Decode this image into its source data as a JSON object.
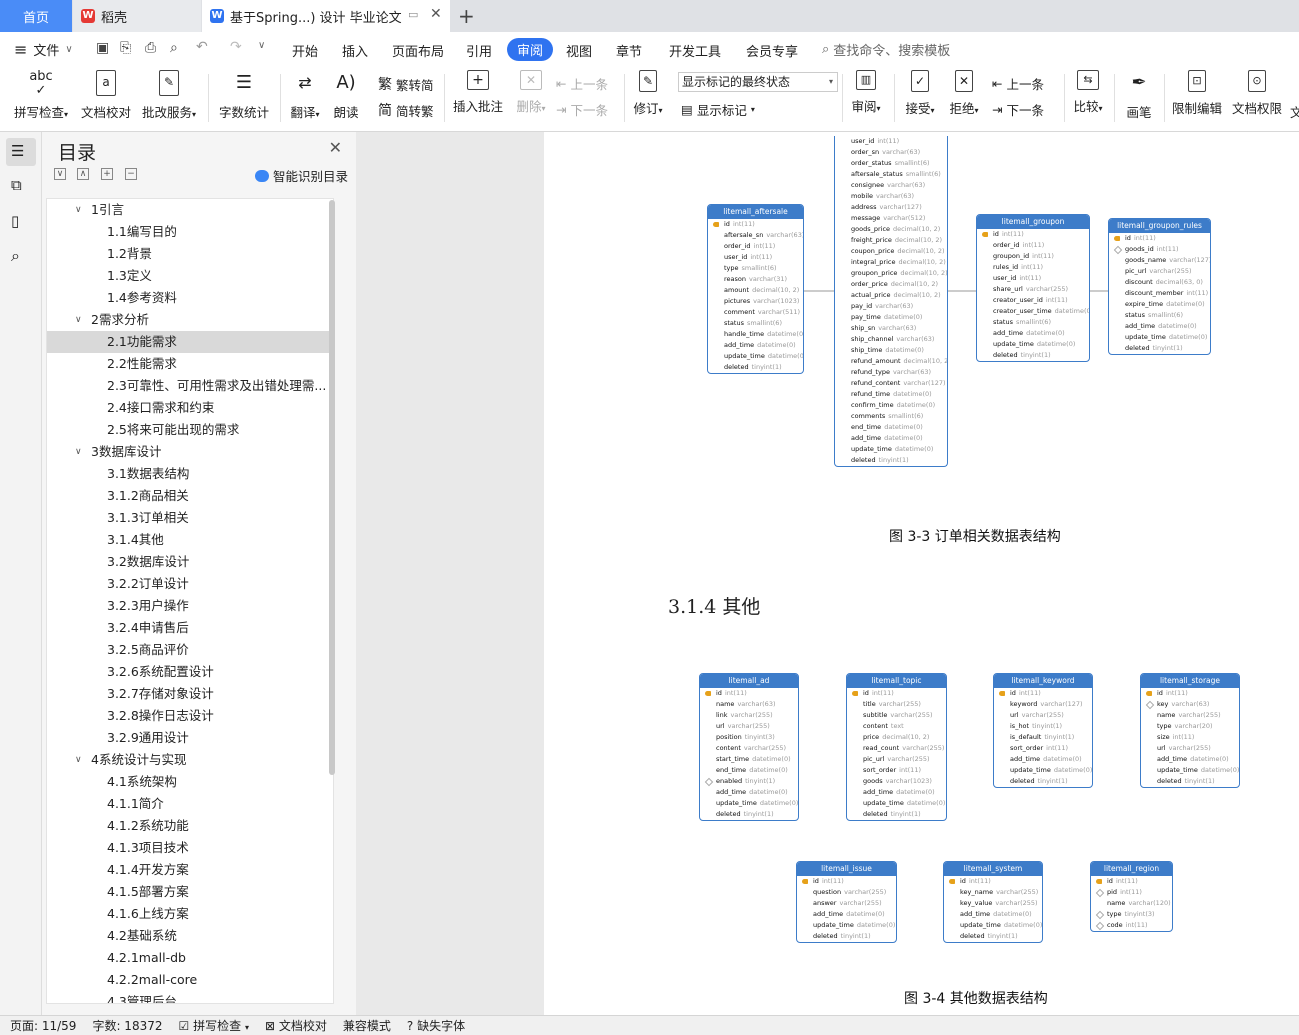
{
  "tabs": {
    "home": "首页",
    "daoke": "稻壳",
    "document": "基于Spring...) 设计 毕业论文",
    "add": "+"
  },
  "menu": {
    "file": "文件",
    "items": [
      "开始",
      "插入",
      "页面布局",
      "引用",
      "审阅",
      "视图",
      "章节",
      "开发工具",
      "会员专享"
    ],
    "search": "查找命令、搜索模板"
  },
  "toolbar": {
    "spell_check": "拼写检查",
    "doc_proofread": "文档校对",
    "batch_service": "批改服务",
    "word_count": "字数统计",
    "translate": "翻译",
    "read_aloud": "朗读",
    "trad_to_simp": "繁转简",
    "simp_to_trad": "简转繁",
    "insert_comment": "插入批注",
    "delete": "删除",
    "prev_comment": "上一条",
    "next_comment": "下一条",
    "revise": "修订",
    "markup_state": "显示标记的最终状态",
    "show_markup": "显示标记",
    "review": "审阅",
    "accept": "接受",
    "reject": "拒绝",
    "prev_change": "上一条",
    "next_change": "下一条",
    "compare": "比较",
    "pen": "画笔",
    "restrict_edit": "限制编辑",
    "doc_permission": "文档权限",
    "overflow": "文"
  },
  "toc": {
    "title": "目录",
    "smart": "智能识别目录",
    "items": [
      {
        "label": "1引言",
        "level": 1,
        "arrow": "∨"
      },
      {
        "label": "1.1编写目的",
        "level": 2
      },
      {
        "label": "1.2背景",
        "level": 2
      },
      {
        "label": "1.3定义",
        "level": 2
      },
      {
        "label": "1.4参考资料",
        "level": 2
      },
      {
        "label": "2需求分析",
        "level": 1,
        "arrow": "∨"
      },
      {
        "label": "2.1功能需求",
        "level": 2,
        "selected": true
      },
      {
        "label": "2.2性能需求",
        "level": 2
      },
      {
        "label": "2.3可靠性、可用性需求及出错处理需...",
        "level": 2
      },
      {
        "label": "2.4接口需求和约束",
        "level": 2
      },
      {
        "label": "2.5将来可能出现的需求",
        "level": 2
      },
      {
        "label": "3数据库设计",
        "level": 1,
        "arrow": "∨"
      },
      {
        "label": "3.1数据表结构",
        "level": 2
      },
      {
        "label": "3.1.2商品相关",
        "level": 2
      },
      {
        "label": "3.1.3订单相关",
        "level": 2
      },
      {
        "label": "3.1.4其他",
        "level": 2
      },
      {
        "label": "3.2数据库设计",
        "level": 2
      },
      {
        "label": "3.2.2订单设计",
        "level": 2
      },
      {
        "label": "3.2.3用户操作",
        "level": 2
      },
      {
        "label": "3.2.4申请售后",
        "level": 2
      },
      {
        "label": "3.2.5商品评价",
        "level": 2
      },
      {
        "label": "3.2.6系统配置设计",
        "level": 2
      },
      {
        "label": "3.2.7存储对象设计",
        "level": 2
      },
      {
        "label": "3.2.8操作日志设计",
        "level": 2
      },
      {
        "label": "3.2.9通用设计",
        "level": 2
      },
      {
        "label": "4系统设计与实现",
        "level": 1,
        "arrow": "∨"
      },
      {
        "label": "4.1系统架构",
        "level": 2
      },
      {
        "label": "4.1.1简介",
        "level": 2
      },
      {
        "label": "4.1.2系统功能",
        "level": 2
      },
      {
        "label": "4.1.3项目技术",
        "level": 2
      },
      {
        "label": "4.1.4开发方案",
        "level": 2
      },
      {
        "label": "4.1.5部署方案",
        "level": 2
      },
      {
        "label": "4.1.6上线方案",
        "level": 2
      },
      {
        "label": "4.2基础系统",
        "level": 2
      },
      {
        "label": "4.2.1mall-db",
        "level": 2
      },
      {
        "label": "4.2.2mall-core",
        "level": 2
      },
      {
        "label": "4.3管理后台",
        "level": 2
      }
    ]
  },
  "document": {
    "caption1": "图 3-3 订单相关数据表结构",
    "heading": "3.1.4 其他",
    "caption2": "图 3-4 其他数据表结构",
    "tables_top": [
      {
        "name": "",
        "rows": [
          [
            "",
            "user_id",
            "int(11)"
          ],
          [
            "",
            "order_sn",
            "varchar(63)"
          ],
          [
            "",
            "order_status",
            "smallint(6)"
          ],
          [
            "",
            "aftersale_status",
            "smallint(6)"
          ],
          [
            "",
            "consignee",
            "varchar(63)"
          ],
          [
            "",
            "mobile",
            "varchar(63)"
          ],
          [
            "",
            "address",
            "varchar(127)"
          ],
          [
            "",
            "message",
            "varchar(512)"
          ],
          [
            "",
            "goods_price",
            "decimal(10, 2)"
          ],
          [
            "",
            "freight_price",
            "decimal(10, 2)"
          ],
          [
            "",
            "coupon_price",
            "decimal(10, 2)"
          ],
          [
            "",
            "integral_price",
            "decimal(10, 2)"
          ],
          [
            "",
            "groupon_price",
            "decimal(10, 2)"
          ],
          [
            "",
            "order_price",
            "decimal(10, 2)"
          ],
          [
            "",
            "actual_price",
            "decimal(10, 2)"
          ],
          [
            "",
            "pay_id",
            "varchar(63)"
          ],
          [
            "",
            "pay_time",
            "datetime(0)"
          ],
          [
            "",
            "ship_sn",
            "varchar(63)"
          ],
          [
            "",
            "ship_channel",
            "varchar(63)"
          ],
          [
            "",
            "ship_time",
            "datetime(0)"
          ],
          [
            "",
            "refund_amount",
            "decimal(10, 2)"
          ],
          [
            "",
            "refund_type",
            "varchar(63)"
          ],
          [
            "",
            "refund_content",
            "varchar(127)"
          ],
          [
            "",
            "refund_time",
            "datetime(0)"
          ],
          [
            "",
            "confirm_time",
            "datetime(0)"
          ],
          [
            "",
            "comments",
            "smallint(6)"
          ],
          [
            "",
            "end_time",
            "datetime(0)"
          ],
          [
            "",
            "add_time",
            "datetime(0)"
          ],
          [
            "",
            "update_time",
            "datetime(0)"
          ],
          [
            "",
            "deleted",
            "tinyint(1)"
          ]
        ]
      },
      {
        "name": "litemall_aftersale",
        "rows": [
          [
            "pk",
            "id",
            "int(11)"
          ],
          [
            "",
            "aftersale_sn",
            "varchar(63)"
          ],
          [
            "",
            "order_id",
            "int(11)"
          ],
          [
            "",
            "user_id",
            "int(11)"
          ],
          [
            "",
            "type",
            "smallint(6)"
          ],
          [
            "",
            "reason",
            "varchar(31)"
          ],
          [
            "",
            "amount",
            "decimal(10, 2)"
          ],
          [
            "",
            "pictures",
            "varchar(1023)"
          ],
          [
            "",
            "comment",
            "varchar(511)"
          ],
          [
            "",
            "status",
            "smallint(6)"
          ],
          [
            "",
            "handle_time",
            "datetime(0)"
          ],
          [
            "",
            "add_time",
            "datetime(0)"
          ],
          [
            "",
            "update_time",
            "datetime(0)"
          ],
          [
            "",
            "deleted",
            "tinyint(1)"
          ]
        ]
      },
      {
        "name": "litemall_groupon",
        "rows": [
          [
            "pk",
            "id",
            "int(11)"
          ],
          [
            "",
            "order_id",
            "int(11)"
          ],
          [
            "",
            "groupon_id",
            "int(11)"
          ],
          [
            "",
            "rules_id",
            "int(11)"
          ],
          [
            "",
            "user_id",
            "int(11)"
          ],
          [
            "",
            "share_url",
            "varchar(255)"
          ],
          [
            "",
            "creator_user_id",
            "int(11)"
          ],
          [
            "",
            "creator_user_time",
            "datetime(0)"
          ],
          [
            "",
            "status",
            "smallint(6)"
          ],
          [
            "",
            "add_time",
            "datetime(0)"
          ],
          [
            "",
            "update_time",
            "datetime(0)"
          ],
          [
            "",
            "deleted",
            "tinyint(1)"
          ]
        ]
      },
      {
        "name": "litemall_groupon_rules",
        "rows": [
          [
            "pk",
            "id",
            "int(11)"
          ],
          [
            "fk",
            "goods_id",
            "int(11)"
          ],
          [
            "",
            "goods_name",
            "varchar(127)"
          ],
          [
            "",
            "pic_url",
            "varchar(255)"
          ],
          [
            "",
            "discount",
            "decimal(63, 0)"
          ],
          [
            "",
            "discount_member",
            "int(11)"
          ],
          [
            "",
            "expire_time",
            "datetime(0)"
          ],
          [
            "",
            "status",
            "smallint(6)"
          ],
          [
            "",
            "add_time",
            "datetime(0)"
          ],
          [
            "",
            "update_time",
            "datetime(0)"
          ],
          [
            "",
            "deleted",
            "tinyint(1)"
          ]
        ]
      }
    ],
    "tables_bottom": [
      {
        "name": "litemall_ad",
        "rows": [
          [
            "pk",
            "id",
            "int(11)"
          ],
          [
            "",
            "name",
            "varchar(63)"
          ],
          [
            "",
            "link",
            "varchar(255)"
          ],
          [
            "",
            "url",
            "varchar(255)"
          ],
          [
            "",
            "position",
            "tinyint(3)"
          ],
          [
            "",
            "content",
            "varchar(255)"
          ],
          [
            "",
            "start_time",
            "datetime(0)"
          ],
          [
            "",
            "end_time",
            "datetime(0)"
          ],
          [
            "fk",
            "enabled",
            "tinyint(1)"
          ],
          [
            "",
            "add_time",
            "datetime(0)"
          ],
          [
            "",
            "update_time",
            "datetime(0)"
          ],
          [
            "",
            "deleted",
            "tinyint(1)"
          ]
        ]
      },
      {
        "name": "litemall_topic",
        "rows": [
          [
            "pk",
            "id",
            "int(11)"
          ],
          [
            "",
            "title",
            "varchar(255)"
          ],
          [
            "",
            "subtitle",
            "varchar(255)"
          ],
          [
            "",
            "content",
            "text"
          ],
          [
            "",
            "price",
            "decimal(10, 2)"
          ],
          [
            "",
            "read_count",
            "varchar(255)"
          ],
          [
            "",
            "pic_url",
            "varchar(255)"
          ],
          [
            "",
            "sort_order",
            "int(11)"
          ],
          [
            "",
            "goods",
            "varchar(1023)"
          ],
          [
            "",
            "add_time",
            "datetime(0)"
          ],
          [
            "",
            "update_time",
            "datetime(0)"
          ],
          [
            "",
            "deleted",
            "tinyint(1)"
          ]
        ]
      },
      {
        "name": "litemall_keyword",
        "rows": [
          [
            "pk",
            "id",
            "int(11)"
          ],
          [
            "",
            "keyword",
            "varchar(127)"
          ],
          [
            "",
            "url",
            "varchar(255)"
          ],
          [
            "",
            "is_hot",
            "tinyint(1)"
          ],
          [
            "",
            "is_default",
            "tinyint(1)"
          ],
          [
            "",
            "sort_order",
            "int(11)"
          ],
          [
            "",
            "add_time",
            "datetime(0)"
          ],
          [
            "",
            "update_time",
            "datetime(0)"
          ],
          [
            "",
            "deleted",
            "tinyint(1)"
          ]
        ]
      },
      {
        "name": "litemall_storage",
        "rows": [
          [
            "pk",
            "id",
            "int(11)"
          ],
          [
            "fk",
            "key",
            "varchar(63)"
          ],
          [
            "",
            "name",
            "varchar(255)"
          ],
          [
            "",
            "type",
            "varchar(20)"
          ],
          [
            "",
            "size",
            "int(11)"
          ],
          [
            "",
            "url",
            "varchar(255)"
          ],
          [
            "",
            "add_time",
            "datetime(0)"
          ],
          [
            "",
            "update_time",
            "datetime(0)"
          ],
          [
            "",
            "deleted",
            "tinyint(1)"
          ]
        ]
      },
      {
        "name": "litemall_issue",
        "rows": [
          [
            "pk",
            "id",
            "int(11)"
          ],
          [
            "",
            "question",
            "varchar(255)"
          ],
          [
            "",
            "answer",
            "varchar(255)"
          ],
          [
            "",
            "add_time",
            "datetime(0)"
          ],
          [
            "",
            "update_time",
            "datetime(0)"
          ],
          [
            "",
            "deleted",
            "tinyint(1)"
          ]
        ]
      },
      {
        "name": "litemall_system",
        "rows": [
          [
            "pk",
            "id",
            "int(11)"
          ],
          [
            "",
            "key_name",
            "varchar(255)"
          ],
          [
            "",
            "key_value",
            "varchar(255)"
          ],
          [
            "",
            "add_time",
            "datetime(0)"
          ],
          [
            "",
            "update_time",
            "datetime(0)"
          ],
          [
            "",
            "deleted",
            "tinyint(1)"
          ]
        ]
      },
      {
        "name": "litemall_region",
        "rows": [
          [
            "pk",
            "id",
            "int(11)"
          ],
          [
            "fk",
            "pid",
            "int(11)"
          ],
          [
            "",
            "name",
            "varchar(120)"
          ],
          [
            "fk",
            "type",
            "tinyint(3)"
          ],
          [
            "fk",
            "code",
            "int(11)"
          ]
        ]
      }
    ]
  },
  "status": {
    "page": "页面: 11/59",
    "words": "字数: 18372",
    "spell": "拼写检查",
    "proof": "文档校对",
    "compat": "兼容模式",
    "missing_font": "缺失字体"
  },
  "colors": {
    "accent": "#2f73f0",
    "table_header": "#3d7cc9",
    "home_tab": "#4a8cf7"
  }
}
